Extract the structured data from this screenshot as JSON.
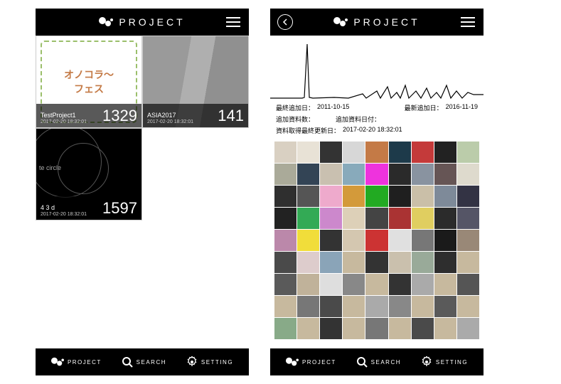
{
  "brand_text": "PROJECT",
  "nav": {
    "project": "PROJECT",
    "search": "SEARCH",
    "setting": "SETTING"
  },
  "left": {
    "cards": [
      {
        "title": "TestProject1",
        "date": "2017-02-20 18:32:01",
        "count": "1329"
      },
      {
        "title": "ASIA2017",
        "date": "2017-02-20 18:32:01",
        "count": "141"
      },
      {
        "title": "4 3 d",
        "date": "2017-02-20 18:32:01",
        "count": "1597"
      }
    ],
    "fes_text": "オノコラ〜\nフェス"
  },
  "right": {
    "detail": {
      "last_added_label": "最終追加日：",
      "last_added_value": "2011-10-15",
      "newest_added_label": "最新追加日：",
      "newest_added_value": "2016-11-19",
      "added_count_label": "追加資料数：",
      "added_date_label": "追加資料日付：",
      "fetched_label": "資料取得最終更新日：",
      "fetched_value": "2017-02-20 18:32:01"
    }
  },
  "mosaic_colors": [
    "#d9d0c2",
    "#e8e2d6",
    "#333",
    "#d7d7d7",
    "#c47a46",
    "#1d3a4a",
    "#c43a3a",
    "#222",
    "#bca",
    "#aa9",
    "#345",
    "#c9c0b0",
    "#8ab",
    "#e3d",
    "#2a2a2a",
    "#8993a0",
    "#655",
    "#dedacd",
    "#2f2f2f",
    "#555",
    "#eac",
    "#d39a3a",
    "#2a2",
    "#1f1f1f",
    "#cabfa8",
    "#7e8a99",
    "#334",
    "#222",
    "#3a5",
    "#c8c",
    "#ddd0b8",
    "#444",
    "#a33",
    "#e0ce60",
    "#2b2b2b",
    "#556",
    "#b8a",
    "#f1dd3a",
    "#333",
    "#d4c7b0",
    "#c33",
    "#e0e0e0",
    "#777",
    "#1a1a1a",
    "#998877",
    "#4a4a4a",
    "#dcc",
    "#8aa4b8",
    "#c7b99e",
    "#333",
    "#cac0ad",
    "#9a9",
    "#2e2e2e",
    "#c7b99e",
    "#5a5a5a",
    "#c0b29a",
    "#dedede",
    "#888",
    "#c7b99e",
    "#333",
    "#aaa",
    "#c7b99e",
    "#555",
    "#c7b99e",
    "#777",
    "#4a4a4a",
    "#c7b99e",
    "#aaa",
    "#888",
    "#c7b99e",
    "#5a5a5a",
    "#c7b99e",
    "#8a8",
    "#c7b99e",
    "#333",
    "#c7b99e",
    "#777",
    "#c7b99e",
    "#4a4a4a",
    "#c7b99e",
    "#aaa"
  ]
}
